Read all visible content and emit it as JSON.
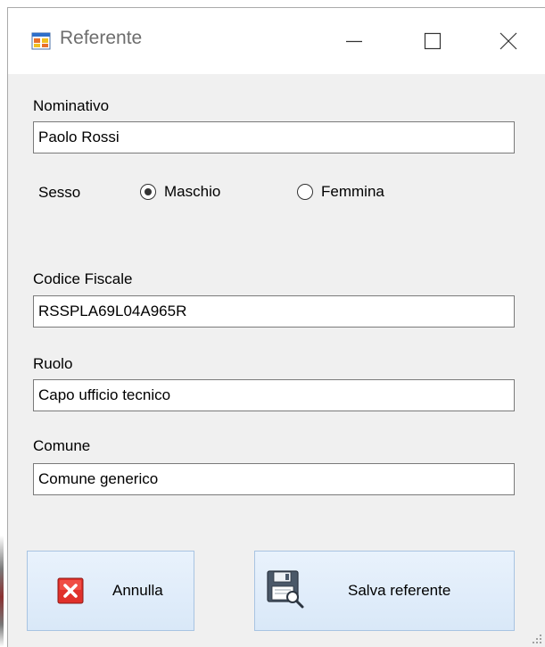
{
  "window": {
    "title": "Referente"
  },
  "form": {
    "nominativo": {
      "label": "Nominativo",
      "value": "Paolo Rossi"
    },
    "sesso": {
      "label": "Sesso",
      "options": [
        {
          "label": "Maschio",
          "selected": true
        },
        {
          "label": "Femmina",
          "selected": false
        }
      ]
    },
    "codice_fiscale": {
      "label": "Codice Fiscale",
      "value": "RSSPLA69L04A965R"
    },
    "ruolo": {
      "label": "Ruolo",
      "value": "Capo ufficio tecnico"
    },
    "comune": {
      "label": "Comune",
      "value": "Comune generico"
    }
  },
  "buttons": {
    "cancel": {
      "label": "Annulla",
      "icon": "close-x-icon"
    },
    "save": {
      "label": "Salva referente",
      "icon": "floppy-save-icon"
    }
  },
  "colors": {
    "window_bg": "#f0f0f0",
    "button_bg": "#dde9f7",
    "cancel_icon_red": "#e0302a"
  }
}
